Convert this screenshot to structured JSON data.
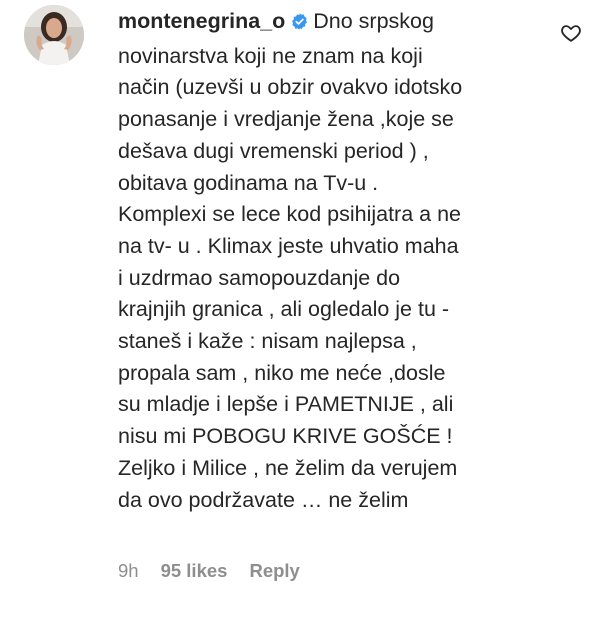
{
  "comment": {
    "username": "montenegrina_o",
    "verified_icon": "verified-badge-icon",
    "text_lines": [
      "Dno srpskog",
      "novinarstva koji ne znam na koji",
      "način (uzevši u obzir ovakvo idotsko",
      "ponasanje i vredjanje žena ,koje se",
      "dešava dugi vremenski period ) ,",
      "obitava godinama na Tv-u .",
      "Komplexi se lece kod psihijatra a ne",
      "na tv- u . Klimax jeste uhvatio maha",
      "i uzdrmao samopouzdanje do",
      "krajnjih granica , ali ogledalo je tu -",
      "staneš i kaže : nisam najlepsa ,",
      "propala sam , niko me neće ,dosle",
      "su mladje i lepše i PAMETNIJE , ali",
      "nisu mi POBOGU KRIVE GOŠĆE !",
      "Zeljko i Milice , ne želim da verujem",
      "da ovo podržavate … ne želim"
    ],
    "time": "9h",
    "likes": "95 likes",
    "reply_label": "Reply",
    "like_icon": "heart-outline-icon",
    "verified_color": "#3897f0"
  }
}
